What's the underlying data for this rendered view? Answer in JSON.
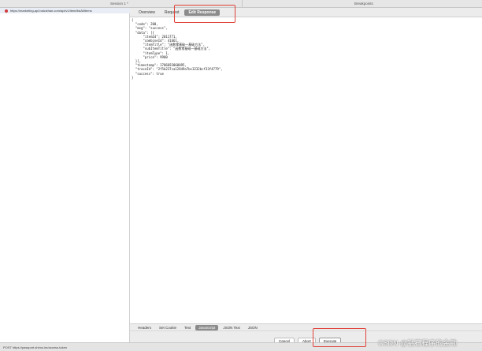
{
  "topbar": {
    "left_title": "Session 1 *",
    "right_title": "Breakpoints"
  },
  "left": {
    "request_url": "https://marketing-api.baicizhan.com/api/v1/item/listAllItems"
  },
  "tabs": [
    "Overview",
    "Request",
    "Edit Response"
  ],
  "active_tab": "Edit Response",
  "code_lines": [
    "{",
    "  \"code\": 200,",
    "  \"msg\": \"success\",",
    "  \"data\": [{",
    "      \"itemId\": 2011771,",
    "      \"combineId\": 41661,",
    "      \"itemTitle\": \"函数零基础一基础方法\",",
    "      \"subItemTitle\": \"函数零基础一基础方法\",",
    "      \"itemType\": 1,",
    "      \"price\": 9900",
    "  }],",
    "  \"timestamp\": 1706693060095,",
    "  \"traceId\": \"2f5b237ca12849a7bc3232bcf33f4779\",",
    "  \"success\": true",
    "}"
  ],
  "bottom_tabs": [
    "Headers",
    "Set Cookie",
    "Text",
    "JavaScript",
    "JSON Text",
    "JSON"
  ],
  "active_bottom_tab": "JavaScript",
  "buttons": {
    "cancel": "Cancel",
    "abort": "Abort",
    "execute": "Execute"
  },
  "status": {
    "text": "POST https://passport.shimo.im/access-token"
  },
  "watermark": "CSDN @钻石程序的金锄",
  "colors": {
    "highlight": "#e0433a",
    "breakpoint": "#d23a3a",
    "active_tab_bg": "#8b8b8b"
  }
}
